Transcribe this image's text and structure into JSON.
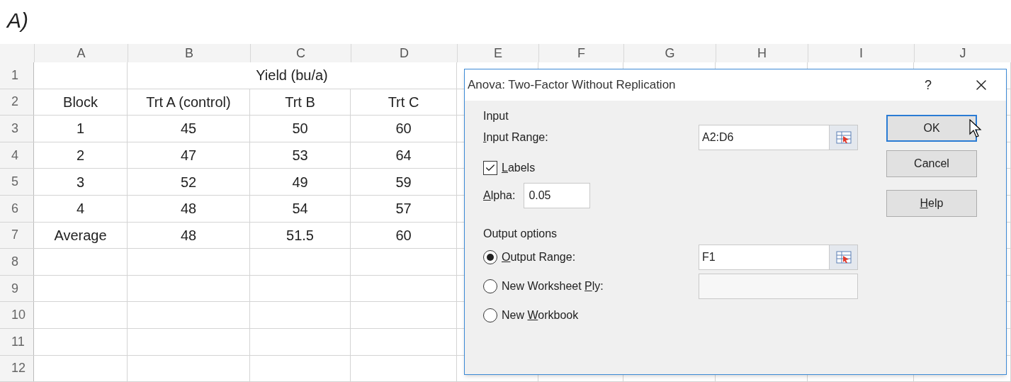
{
  "figure_label": "A)",
  "sheet": {
    "columns": [
      "A",
      "B",
      "C",
      "D",
      "E",
      "F",
      "G",
      "H",
      "I",
      "J"
    ],
    "rows": [
      {
        "number": "1",
        "title": "Yield (bu/a)"
      },
      {
        "number": "2",
        "cells": [
          "Block",
          "Trt A (control)",
          "Trt B",
          "Trt C"
        ]
      },
      {
        "number": "3",
        "cells": [
          "1",
          "45",
          "50",
          "60"
        ]
      },
      {
        "number": "4",
        "cells": [
          "2",
          "47",
          "53",
          "64"
        ]
      },
      {
        "number": "5",
        "cells": [
          "3",
          "52",
          "49",
          "59"
        ]
      },
      {
        "number": "6",
        "cells": [
          "4",
          "48",
          "54",
          "57"
        ]
      },
      {
        "number": "7",
        "cells": [
          "Average",
          "48",
          "51.5",
          "60"
        ]
      },
      {
        "number": "8"
      },
      {
        "number": "9"
      },
      {
        "number": "10"
      },
      {
        "number": "11"
      },
      {
        "number": "12"
      }
    ]
  },
  "dialog": {
    "title": "Anova: Two-Factor Without Replication",
    "help": "?",
    "input": {
      "heading": "Input",
      "range_label": {
        "key": "I",
        "post": "nput Range:"
      },
      "range_value": "A2:D6",
      "labels": {
        "label": {
          "key": "L",
          "post": "abels"
        },
        "checked": true
      },
      "alpha_label": {
        "key": "A",
        "post": "lpha:"
      },
      "alpha_value": "0.05"
    },
    "output": {
      "heading": "Output options",
      "options": [
        {
          "label": {
            "key": "O",
            "post": "utput Range:"
          },
          "selected": true,
          "kind": "range",
          "value": "F1"
        },
        {
          "label": {
            "pre": "New Worksheet ",
            "key": "P",
            "post": "ly:"
          },
          "selected": false,
          "kind": "name"
        },
        {
          "label": {
            "pre": "New ",
            "key": "W",
            "post": "orkbook"
          },
          "selected": false,
          "kind": "plain"
        }
      ]
    },
    "buttons": [
      {
        "label": {
          "pre": "OK"
        },
        "default": true
      },
      {
        "label": {
          "pre": "Cancel"
        },
        "default": false
      },
      {
        "label": {
          "key": "H",
          "post": "elp"
        },
        "default": false
      }
    ]
  }
}
